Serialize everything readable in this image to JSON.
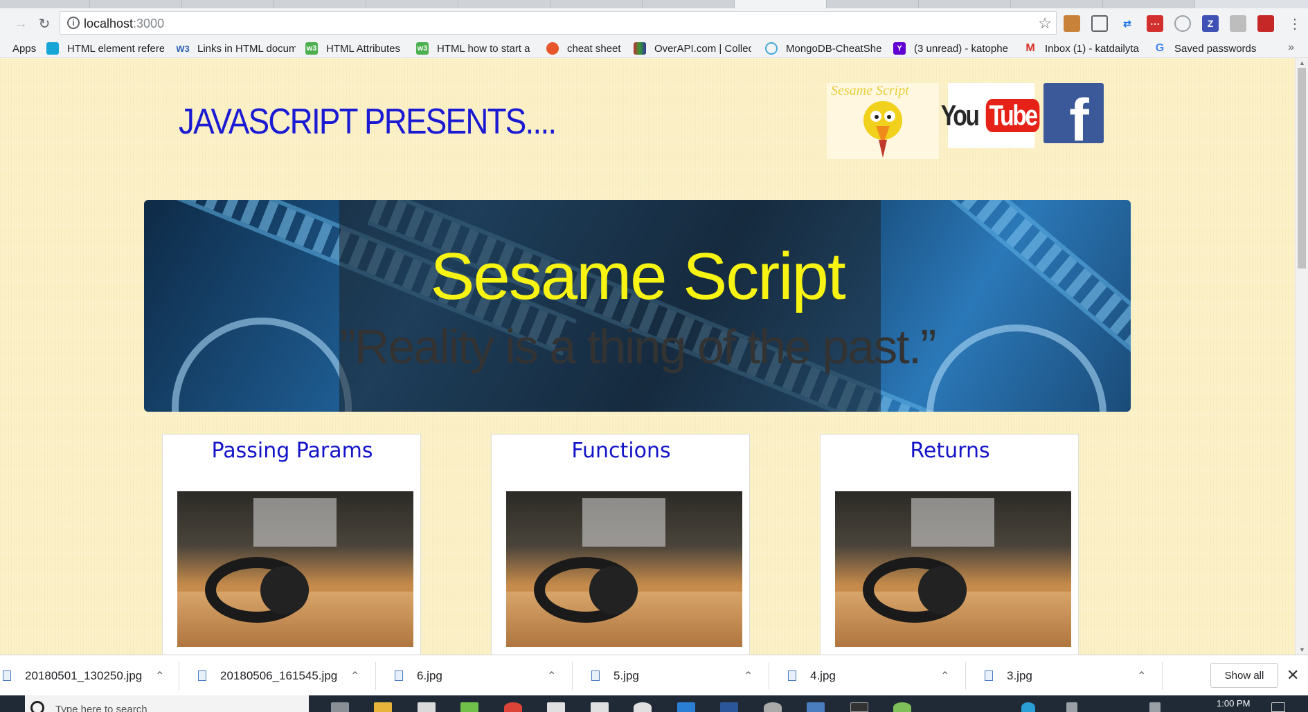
{
  "browser": {
    "url_host": "localhost",
    "url_port": ":3000",
    "bookmarks": [
      {
        "label": "Apps",
        "icon": "apps-grid-icon",
        "color": "#4285f4"
      },
      {
        "label": "HTML element refere",
        "icon": "mdn-icon",
        "color": "#15a5d7"
      },
      {
        "label": "Links in HTML docum",
        "icon": "w3-icon",
        "color": "#2a5db0"
      },
      {
        "label": "HTML Attributes",
        "icon": "w3schools-icon",
        "color": "#4caf50"
      },
      {
        "label": "HTML how to start a",
        "icon": "w3schools-icon",
        "color": "#4caf50"
      },
      {
        "label": "cheat sheet",
        "icon": "fox-icon",
        "color": "#e8572a"
      },
      {
        "label": "OverAPI.com | Collec",
        "icon": "overapi-icon",
        "color": "#8b3b3b"
      },
      {
        "label": "MongoDB-CheatShe",
        "icon": "mongodb-icon",
        "color": "#47a9d6"
      },
      {
        "label": "(3 unread) - katophe",
        "icon": "yahoo-icon",
        "color": "#5f01d1"
      },
      {
        "label": "Inbox (1) - katdailyta",
        "icon": "gmail-icon",
        "color": "#d93025"
      },
      {
        "label": "Saved passwords",
        "icon": "google-icon",
        "color": "#4285f4"
      }
    ],
    "bookmarks_more": "»"
  },
  "page": {
    "presents": "JAVASCRIPT PRESENTS....",
    "social": {
      "sesame_logo_text": "Sesame Script",
      "youtube_you": "You",
      "youtube_tube": "Tube",
      "facebook_letter": "f"
    },
    "banner": {
      "title": "Sesame Script",
      "quote": "”Reality is a thing of the past.”"
    },
    "cards": [
      {
        "title": "Passing Params"
      },
      {
        "title": "Functions"
      },
      {
        "title": "Returns"
      }
    ],
    "colors": {
      "heading_blue": "#1a1ad4",
      "banner_title": "#f7f312",
      "card_title": "#1313c8",
      "page_bg": "#fbf0c4"
    }
  },
  "downloads": {
    "items": [
      {
        "name": "20180501_130250.jpg"
      },
      {
        "name": "20180506_161545.jpg"
      },
      {
        "name": "6.jpg"
      },
      {
        "name": "5.jpg"
      },
      {
        "name": "4.jpg"
      },
      {
        "name": "3.jpg"
      }
    ],
    "show_all": "Show all",
    "close": "✕"
  },
  "taskbar": {
    "search_placeholder": "Type here to search",
    "clock": "1:00 PM"
  }
}
